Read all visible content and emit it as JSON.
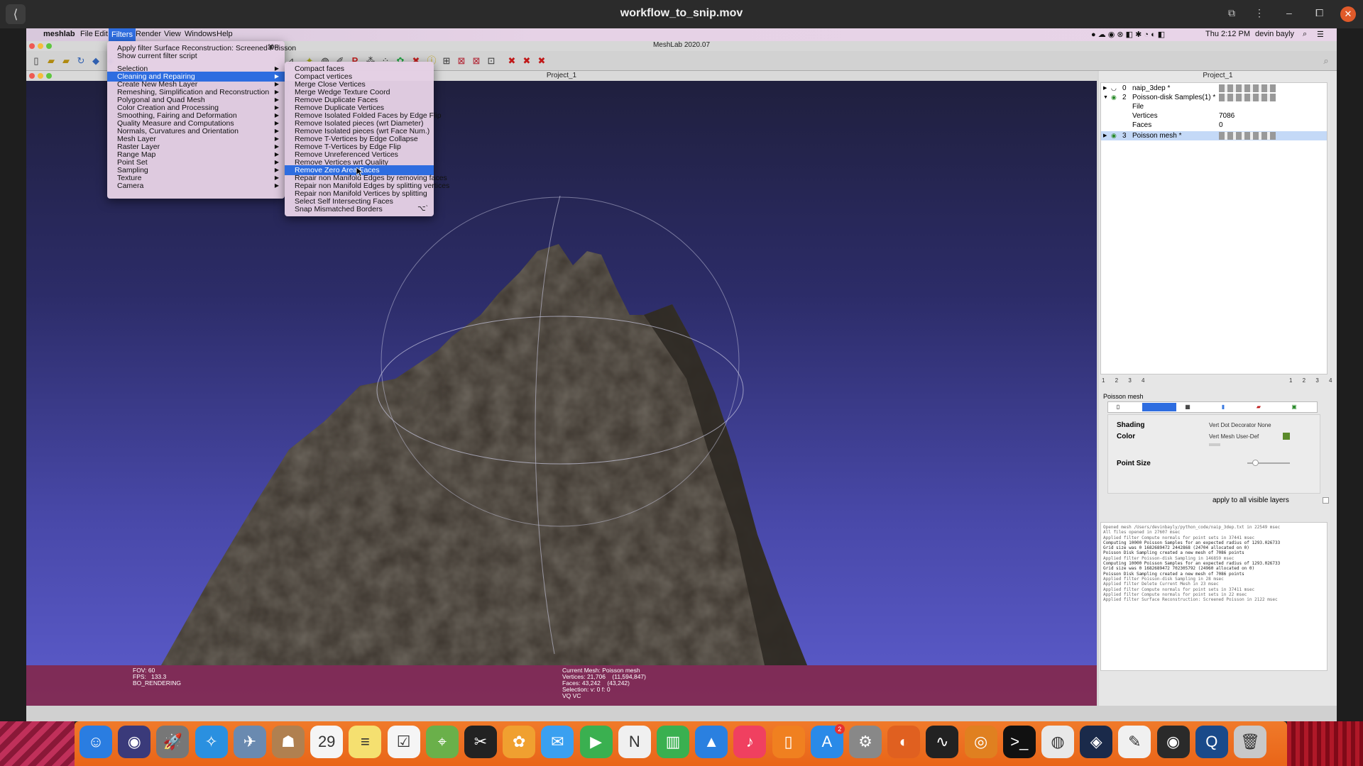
{
  "player": {
    "title": "workflow_to_snip.mov",
    "back": "⟨",
    "btn_pip": "⧉",
    "btn_more": "⋮",
    "btn_min": "–",
    "btn_restore": "⧠",
    "btn_close": "✕"
  },
  "menubar": {
    "apple": "",
    "items": [
      "meshlab",
      "File",
      "Edit",
      "Filters",
      "Render",
      "View",
      "Windows",
      "Help"
    ],
    "clock": "Thu 2:12 PM",
    "user": "devin bayly",
    "search_glyph": "⌕",
    "list_glyph": "☰"
  },
  "app": {
    "title": "MeshLab 2020.07",
    "viewport_title": "Project_1",
    "panel_title": "Project_1"
  },
  "filters_menu": {
    "items": [
      {
        "label": "Apply filter Surface Reconstruction: Screened Poisson",
        "shortcut": "⌘P"
      },
      {
        "label": "Show current filter script"
      },
      {
        "label": "Selection",
        "sub": true
      },
      {
        "label": "Cleaning and Repairing",
        "sub": true,
        "highlight": true
      },
      {
        "label": "Create New Mesh Layer",
        "sub": true
      },
      {
        "label": "Remeshing, Simplification and Reconstruction",
        "sub": true
      },
      {
        "label": "Polygonal and Quad Mesh",
        "sub": true
      },
      {
        "label": "Color Creation and Processing",
        "sub": true
      },
      {
        "label": "Smoothing, Fairing and Deformation",
        "sub": true
      },
      {
        "label": "Quality Measure and Computations",
        "sub": true
      },
      {
        "label": "Normals, Curvatures and Orientation",
        "sub": true
      },
      {
        "label": "Mesh Layer",
        "sub": true
      },
      {
        "label": "Raster Layer",
        "sub": true
      },
      {
        "label": "Range Map",
        "sub": true
      },
      {
        "label": "Point Set",
        "sub": true
      },
      {
        "label": "Sampling",
        "sub": true
      },
      {
        "label": "Texture",
        "sub": true
      },
      {
        "label": "Camera",
        "sub": true
      }
    ]
  },
  "cleaning_menu": {
    "items": [
      {
        "label": "Compact faces"
      },
      {
        "label": "Compact vertices"
      },
      {
        "label": "Merge Close Vertices"
      },
      {
        "label": "Merge Wedge Texture Coord"
      },
      {
        "label": "Remove Duplicate Faces"
      },
      {
        "label": "Remove Duplicate Vertices"
      },
      {
        "label": "Remove Isolated Folded Faces by Edge Flip"
      },
      {
        "label": "Remove Isolated pieces (wrt Diameter)"
      },
      {
        "label": "Remove Isolated pieces (wrt Face Num.)"
      },
      {
        "label": "Remove T-Vertices by Edge Collapse"
      },
      {
        "label": "Remove T-Vertices by Edge Flip"
      },
      {
        "label": "Remove Unreferenced Vertices"
      },
      {
        "label": "Remove Vertices wrt Quality"
      },
      {
        "label": "Remove Zero Area Faces",
        "highlight": true
      },
      {
        "label": "Repair non Manifold Edges by removing faces"
      },
      {
        "label": "Repair non Manifold Edges by splitting vertices"
      },
      {
        "label": "Repair non Manifold Vertices by splitting"
      },
      {
        "label": "Select Self Intersecting Faces"
      },
      {
        "label": "Snap Mismatched Borders",
        "shortcut": "⌥`"
      }
    ]
  },
  "layers": {
    "rows": [
      {
        "num": "0",
        "name": "naip_3dep *"
      },
      {
        "num": "2",
        "name": "Poisson-disk Samples(1) *"
      },
      {
        "num": "3",
        "name": "Poisson mesh *",
        "selected": true
      }
    ],
    "details": [
      {
        "key": "File",
        "val": ""
      },
      {
        "key": "Vertices",
        "val": "7086"
      },
      {
        "key": "Faces",
        "val": "0"
      }
    ],
    "pages_left": "1 2 3 4",
    "pages_right": "1 2 3 4"
  },
  "decorator": {
    "mesh_label": "Poisson mesh",
    "shading_label": "Shading",
    "shading_opts": "Vert   Dot Decorator   None",
    "color_label": "Color",
    "color_opts": "Vert   Mesh   User-Def",
    "point_size_label": "Point Size",
    "apply_all": "apply to all visible layers",
    "color_swatch": "#5a8a2a"
  },
  "viewport_info": {
    "left": "FOV: 60\nFPS:   133.3\nBO_RENDERING",
    "center": "Current Mesh: Poisson mesh\nVertices: 21,706    (11,594,847)\nFaces: 43,242    (43,242)\nSelection: v: 0 f: 0\nVQ VC"
  },
  "log": [
    "Opened mesh /Users/devinbayly/python_code/naip_3dep.txt in 22549 msec",
    "All files opened in 27607 msec",
    "Applied filter Compute normals for point sets in 37441 msec",
    "Computing 10000 Poisson Samples for an expected radius of 1293.026733",
    "Grid size was 0 1682689472 2442868 (24704 allocated on 0)",
    "Poisson Disk Sampling created a new mesh of 7086 points",
    "Applied filter Poisson-disk Sampling in 146859 msec",
    "Computing 10000 Poisson Samples for an expected radius of 1293.026733",
    "Grid size was 0 1682689472 702305792 (24960 allocated on 0)",
    "Poisson Disk Sampling created a new mesh of 7086 points",
    "Applied filter Poisson-disk Sampling in 28 msec",
    "Applied filter Delete Current Mesh in 23 msec",
    "Applied filter Compute normals for point sets in 37411 msec",
    "Applied filter Compute normals for point sets in 22 msec",
    "",
    "Applied filter Surface Reconstruction: Screened Poisson in 2122 msec"
  ],
  "dock": {
    "icons": [
      {
        "name": "finder-icon",
        "glyph": "☺",
        "color": "#2a7de1"
      },
      {
        "name": "siri-icon",
        "glyph": "◉",
        "color": "#3a3a7a"
      },
      {
        "name": "launchpad-icon",
        "glyph": "🚀",
        "color": "#777"
      },
      {
        "name": "safari-icon",
        "glyph": "✧",
        "color": "#2a90e0"
      },
      {
        "name": "mail-bird-icon",
        "glyph": "✈",
        "color": "#6a8ab0"
      },
      {
        "name": "contacts-icon",
        "glyph": "☗",
        "color": "#b08050"
      },
      {
        "name": "calendar-icon",
        "glyph": "29",
        "color": "#f5f5f5"
      },
      {
        "name": "notes-icon",
        "glyph": "≡",
        "color": "#f5e070"
      },
      {
        "name": "reminders-icon",
        "glyph": "☑",
        "color": "#f5f5f5"
      },
      {
        "name": "maps-icon",
        "glyph": "⌖",
        "color": "#6ab04a"
      },
      {
        "name": "snip-icon",
        "glyph": "✂",
        "color": "#222"
      },
      {
        "name": "photos-icon",
        "glyph": "✿",
        "color": "#f0a030"
      },
      {
        "name": "messages-icon",
        "glyph": "✉",
        "color": "#3aa0f0"
      },
      {
        "name": "facetime-icon",
        "glyph": "▶",
        "color": "#3ab050"
      },
      {
        "name": "news-icon",
        "glyph": "N",
        "color": "#f0f0f0"
      },
      {
        "name": "numbers-icon",
        "glyph": "▥",
        "color": "#3ab050"
      },
      {
        "name": "keynote-icon",
        "glyph": "▲",
        "color": "#2a80e0"
      },
      {
        "name": "music-icon",
        "glyph": "♪",
        "color": "#f04060"
      },
      {
        "name": "books-icon",
        "glyph": "▯",
        "color": "#f08020"
      },
      {
        "name": "appstore-icon",
        "glyph": "A",
        "color": "#2a8ae8"
      },
      {
        "name": "system-preferences-icon",
        "glyph": "⚙",
        "color": "#888"
      },
      {
        "name": "firefox-icon",
        "glyph": "◐",
        "color": "#e06020"
      },
      {
        "name": "activity-monitor-icon",
        "glyph": "∿",
        "color": "#222"
      },
      {
        "name": "blender-icon",
        "glyph": "◎",
        "color": "#e08020"
      },
      {
        "name": "terminal-icon",
        "glyph": ">_",
        "color": "#111"
      },
      {
        "name": "chrome-icon",
        "glyph": "◍",
        "color": "#e8e8e8"
      },
      {
        "name": "steam-icon",
        "glyph": "◈",
        "color": "#1a2a4a"
      },
      {
        "name": "textedit-icon",
        "glyph": "✎",
        "color": "#f0f0f0"
      },
      {
        "name": "meshlab-icon",
        "glyph": "◉",
        "color": "#2a2a2a"
      },
      {
        "name": "quicktime-icon",
        "glyph": "Q",
        "color": "#1a4a8a"
      },
      {
        "name": "trash-icon",
        "glyph": "🗑",
        "color": "#c8c8c8"
      }
    ],
    "appstore_badge": "2"
  }
}
